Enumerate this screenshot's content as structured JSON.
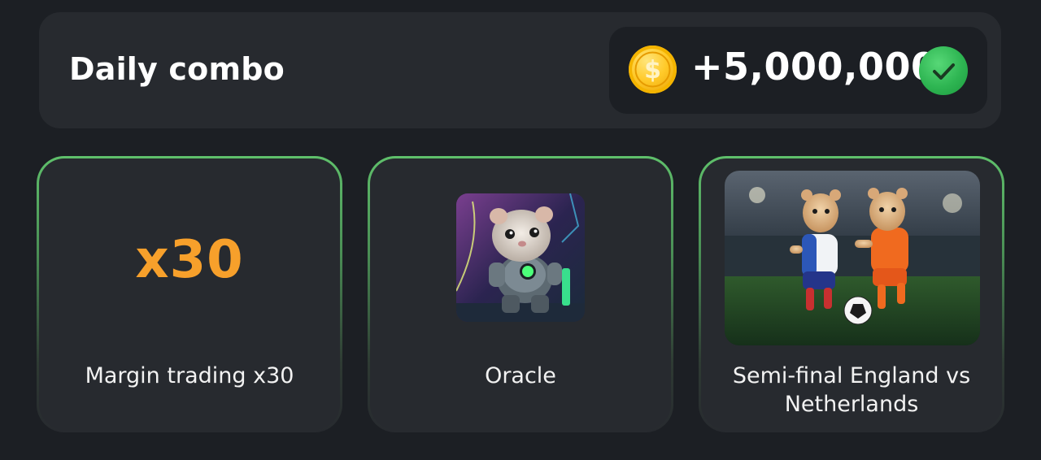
{
  "header": {
    "title": "Daily combo",
    "reward_amount": "+5,000,000",
    "coin_symbol": "$",
    "coin_icon": "coin-icon",
    "status_icon": "checkmark-icon"
  },
  "cards": [
    {
      "badge": "x30",
      "label": "Margin trading x30"
    },
    {
      "image": "hamster-robot-oracle",
      "label": "Oracle"
    },
    {
      "image": "hamsters-playing-football",
      "label": "Semi-final England vs Netherlands"
    }
  ],
  "colors": {
    "background": "#1c1f24",
    "panel": "#272a2f",
    "accent_orange": "#f7a02b",
    "accent_green": "#4caf50",
    "coin_gold": "#ffc928"
  }
}
